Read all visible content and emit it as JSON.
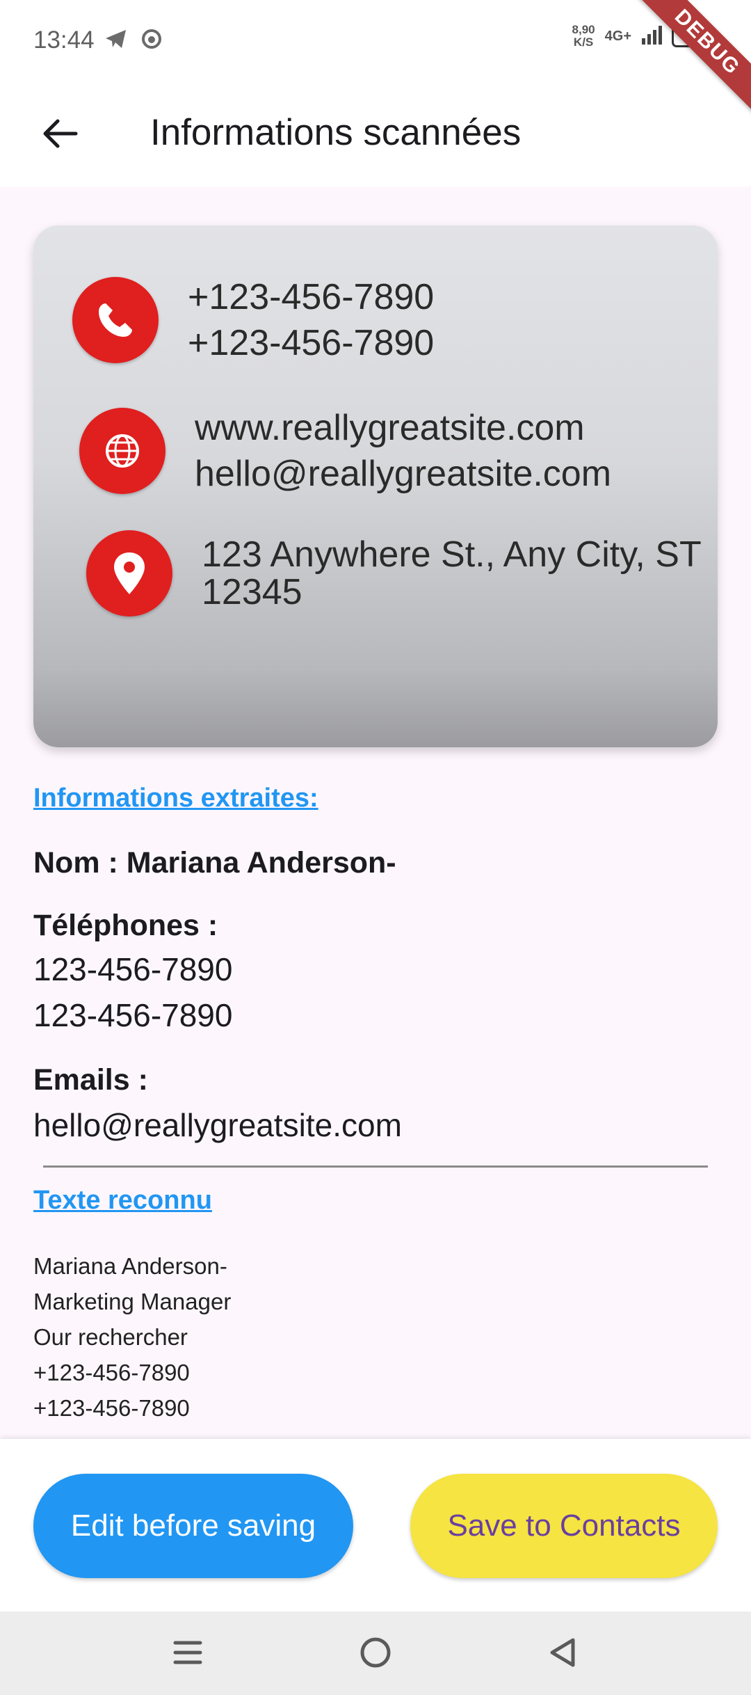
{
  "status_bar": {
    "time": "13:44",
    "net_speed_value": "8,90",
    "net_speed_unit": "K/S",
    "network_type": "4G+",
    "battery_level": "100"
  },
  "debug_banner": "DEBUG",
  "app_bar": {
    "title": "Informations scannées"
  },
  "scanned_card": {
    "phone_lines": [
      "+123-456-7890",
      "+123-456-7890"
    ],
    "web_lines": [
      "www.reallygreatsite.com",
      "hello@reallygreatsite.com"
    ],
    "address_lines": [
      "123 Anywhere St., Any City, ST",
      "12345"
    ]
  },
  "extracted": {
    "section_title": "Informations extraites:",
    "name_line": "Nom : Mariana Anderson-",
    "phones_label": "Téléphones :",
    "phones": [
      "123-456-7890",
      "123-456-7890"
    ],
    "emails_label": "Emails :",
    "emails": [
      "hello@reallygreatsite.com"
    ]
  },
  "recognized": {
    "section_title": "Texte reconnu",
    "lines": [
      "Mariana Anderson-",
      "Marketing Manager",
      "Our rechercher",
      "+123-456-7890",
      "+123-456-7890"
    ]
  },
  "actions": {
    "edit_label": "Edit before saving",
    "save_label": "Save to Contacts"
  },
  "colors": {
    "accent_blue": "#2196f3",
    "save_yellow": "#f5e441",
    "save_text_purple": "#6a3fa0",
    "card_icon_red": "#e01f1f"
  },
  "icons": {
    "back": "arrow-left-icon",
    "phone": "phone-icon",
    "globe": "globe-icon",
    "location": "location-pin-icon",
    "nav_menu": "menu-icon",
    "nav_home": "home-circle-icon",
    "nav_back": "triangle-back-icon"
  }
}
